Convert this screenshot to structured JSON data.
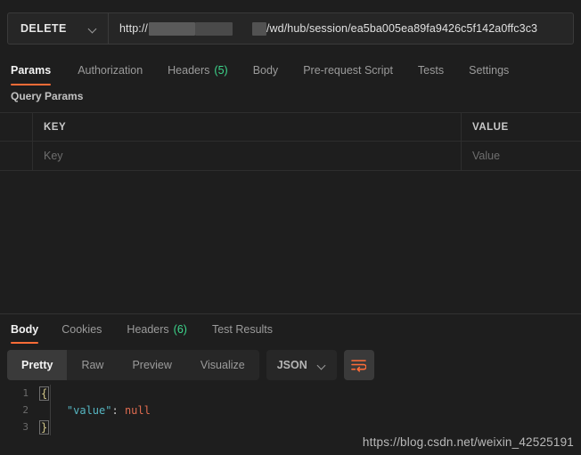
{
  "request": {
    "method": "DELETE",
    "url_prefix": "http://",
    "url_path": "/wd/hub/session/ea5ba005ea89fa9426c5f142a0ffc3c3",
    "url_placeholder": "Enter request URL",
    "tabs": [
      {
        "label": "Params",
        "count": "",
        "active": true
      },
      {
        "label": "Authorization",
        "count": "",
        "active": false
      },
      {
        "label": "Headers",
        "count": "(5)",
        "active": false
      },
      {
        "label": "Body",
        "count": "",
        "active": false
      },
      {
        "label": "Pre-request Script",
        "count": "",
        "active": false
      },
      {
        "label": "Tests",
        "count": "",
        "active": false
      },
      {
        "label": "Settings",
        "count": "",
        "active": false
      }
    ],
    "query_params_label": "Query Params",
    "table": {
      "headers": {
        "key": "KEY",
        "value": "VALUE"
      },
      "rows": [
        {
          "key_placeholder": "Key",
          "value_placeholder": "Value"
        }
      ]
    }
  },
  "response": {
    "tabs": [
      {
        "label": "Body",
        "count": "",
        "active": true
      },
      {
        "label": "Cookies",
        "count": "",
        "active": false
      },
      {
        "label": "Headers",
        "count": "(6)",
        "active": false
      },
      {
        "label": "Test Results",
        "count": "",
        "active": false
      }
    ],
    "formats": [
      {
        "label": "Pretty",
        "active": true
      },
      {
        "label": "Raw",
        "active": false
      },
      {
        "label": "Preview",
        "active": false
      },
      {
        "label": "Visualize",
        "active": false
      }
    ],
    "language": "JSON",
    "wrap_icon": "word-wrap-icon",
    "body_lines": [
      {
        "num": "1",
        "kind": "open-brace",
        "text": "{"
      },
      {
        "num": "2",
        "kind": "pair",
        "key": "\"value\"",
        "colon": ": ",
        "value": "null"
      },
      {
        "num": "3",
        "kind": "close-brace",
        "text": "}"
      }
    ]
  },
  "watermark": "https://blog.csdn.net/weixin_42525191",
  "colors": {
    "accent": "#ff6c37",
    "count_green": "#3dd68c",
    "background": "#1e1e1e",
    "panel": "#262626",
    "json_key": "#56b6c2",
    "json_null": "#e06c50"
  }
}
